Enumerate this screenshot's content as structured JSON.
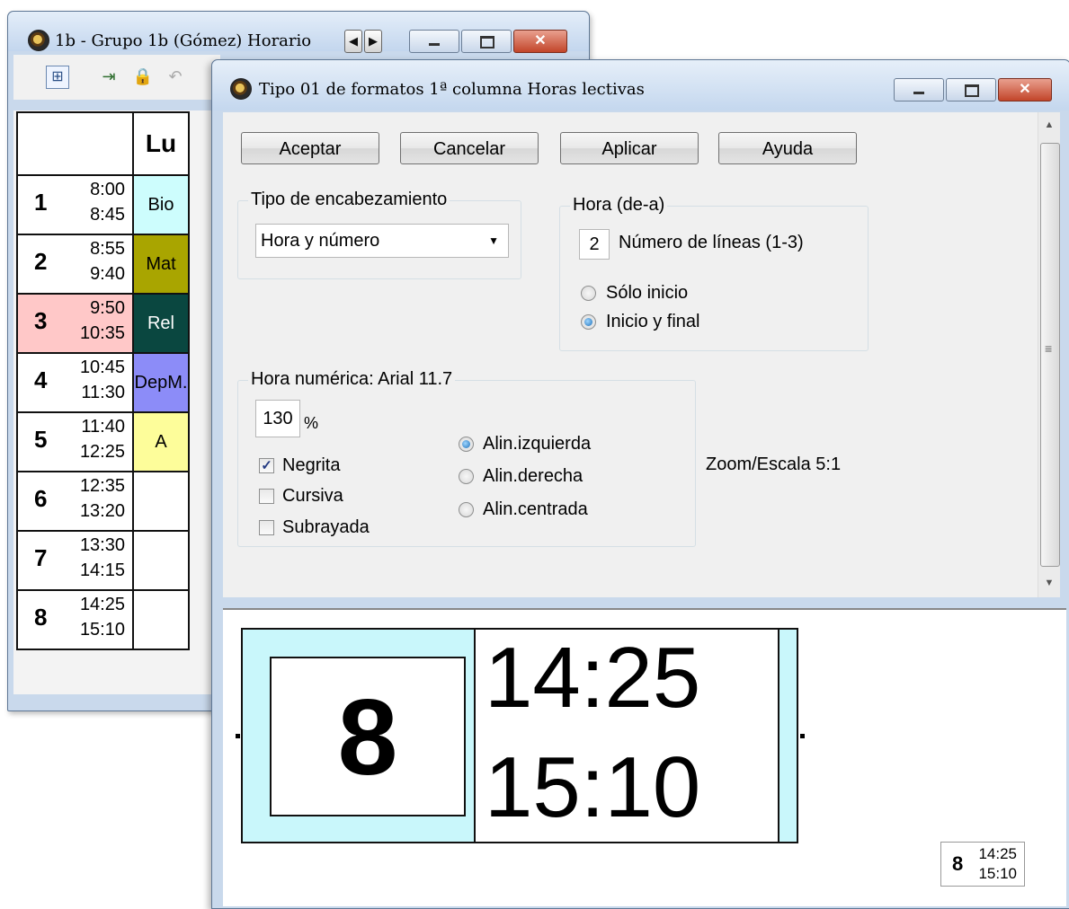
{
  "back_window": {
    "title": "1b - Grupo 1b (Gómez)  Horario",
    "nav_prev": "◀",
    "nav_next": "▶",
    "timetable": {
      "day_header": "Lu",
      "rows": [
        {
          "num": "1",
          "start": "8:00",
          "end": "8:45",
          "subject": "Bio",
          "color": "#cdfdfd"
        },
        {
          "num": "2",
          "start": "8:55",
          "end": "9:40",
          "subject": "Mat",
          "color": "#a9a500"
        },
        {
          "num": "3",
          "start": "9:50",
          "end": "10:35",
          "subject": "Rel",
          "color": "#0a4740",
          "row_color": "#ffc8c8",
          "text_color": "#ffffff"
        },
        {
          "num": "4",
          "start": "10:45",
          "end": "11:30",
          "subject": "DepM.",
          "color": "#8c8cf8"
        },
        {
          "num": "5",
          "start": "11:40",
          "end": "12:25",
          "subject": "A",
          "color": "#fdfd9a"
        },
        {
          "num": "6",
          "start": "12:35",
          "end": "13:20",
          "subject": "",
          "color": "#ffffff"
        },
        {
          "num": "7",
          "start": "13:30",
          "end": "14:15",
          "subject": "",
          "color": "#ffffff"
        },
        {
          "num": "8",
          "start": "14:25",
          "end": "15:10",
          "subject": "",
          "color": "#ffffff"
        }
      ]
    }
  },
  "dialog": {
    "title": "Tipo 01 de formatos  1ª columna  Horas lectivas",
    "buttons": {
      "accept": "Aceptar",
      "cancel": "Cancelar",
      "apply": "Aplicar",
      "help": "Ayuda"
    },
    "header_type": {
      "legend": "Tipo de encabezamiento",
      "selected": "Hora y número"
    },
    "hour_range": {
      "legend": "Hora (de-a)",
      "lines_value": "2",
      "lines_label": "Número de líneas (1-3)",
      "option_start_only": "Sólo inicio",
      "option_start_end": "Inicio y final",
      "selected": "Inicio y final"
    },
    "numeric_hour": {
      "legend": "Hora numérica: Arial 11.7",
      "percent_value": "130",
      "percent_sign": "%",
      "bold_label": "Negrita",
      "bold_checked": true,
      "italic_label": "Cursiva",
      "italic_checked": false,
      "underline_label": "Subrayada",
      "underline_checked": false,
      "align_left": "Alin.izquierda",
      "align_right": "Alin.derecha",
      "align_center": "Alin.centrada",
      "align_selected": "Alin.izquierda"
    },
    "zoom_label": "Zoom/Escala  5:1",
    "preview": {
      "number": "8",
      "start": "14:25",
      "end": "15:10",
      "bg_color": "#c9f7fb"
    }
  }
}
